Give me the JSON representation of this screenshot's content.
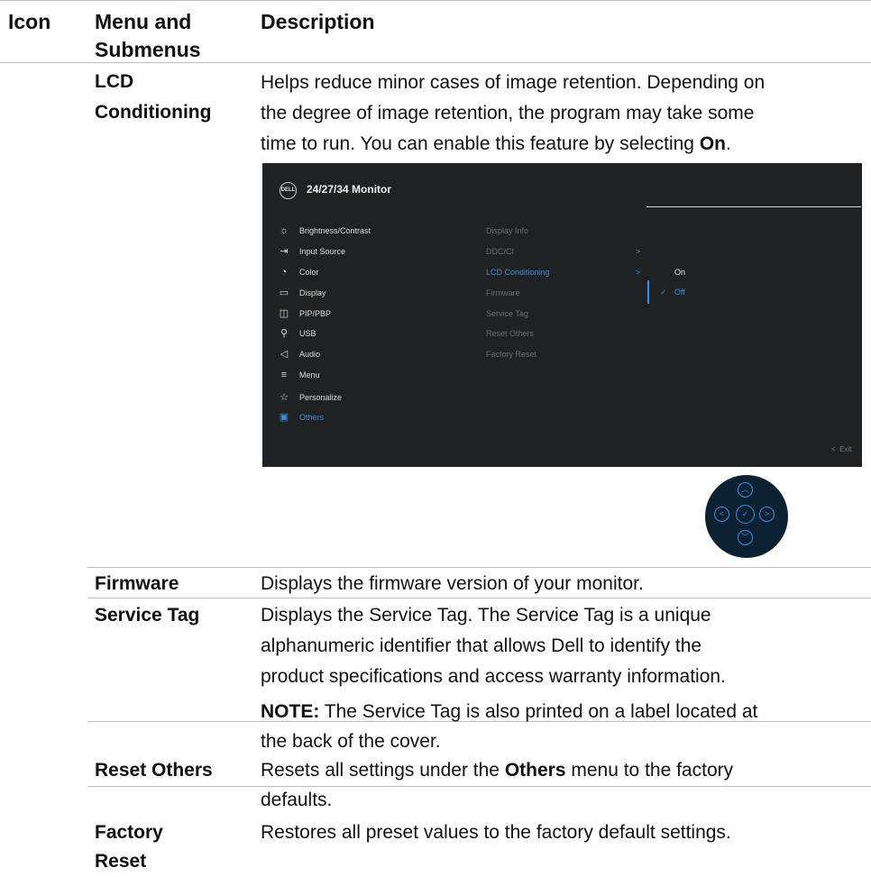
{
  "header": {
    "icon": "Icon",
    "menu_line1": "Menu and",
    "menu_line2": "Submenus",
    "description": "Description"
  },
  "rows": {
    "lcd": {
      "label_line1": "LCD",
      "label_line2": "Conditioning",
      "desc_line1": "Helps reduce minor cases of image retention. Depending on",
      "desc_line2": "the degree of image retention, the program may take some",
      "desc_line3_a": "time to run. You can enable this feature by selecting ",
      "desc_line3_bold": "On",
      "desc_line3_end": "."
    },
    "firmware": {
      "label": "Firmware",
      "desc": "Displays the firmware version of your monitor."
    },
    "service_tag": {
      "label": "Service Tag",
      "desc_line1": "Displays the Service Tag. The Service Tag is a unique",
      "desc_line2": "alphanumeric identifier that allows Dell to identify the",
      "desc_line3": "product specifications and access warranty information.",
      "note_bold": "NOTE:",
      "note_line1_rest": " The Service Tag is also printed on a label located at",
      "note_line2": "the back of the cover."
    },
    "reset_others": {
      "label": "Reset Others",
      "desc_a": "Resets all settings under the ",
      "desc_bold": "Others",
      "desc_b": " menu to the factory",
      "desc_line2": "defaults."
    },
    "factory_reset": {
      "label_line1": "Factory",
      "label_line2": "Reset",
      "desc": "Restores all preset values to the factory default settings."
    }
  },
  "osd": {
    "logo": "DELL",
    "title": "24/27/34 Monitor",
    "menu": [
      {
        "label": "Brightness/Contrast",
        "icon": "brightness-icon",
        "glyph": "☼"
      },
      {
        "label": "Input Source",
        "icon": "input-source-icon",
        "glyph": "⇥"
      },
      {
        "label": "Color",
        "icon": "color-icon",
        "glyph": "◔"
      },
      {
        "label": "Display",
        "icon": "display-icon",
        "glyph": "▭"
      },
      {
        "label": "PIP/PBP",
        "icon": "pip-pbp-icon",
        "glyph": "◫"
      },
      {
        "label": "USB",
        "icon": "usb-icon",
        "glyph": "⚲"
      },
      {
        "label": "Audio",
        "icon": "audio-icon",
        "glyph": "◁"
      },
      {
        "label": "Menu",
        "icon": "menu-icon",
        "glyph": "≡"
      },
      {
        "label": "Personalize",
        "icon": "star-icon",
        "glyph": "☆"
      },
      {
        "label": "Others",
        "icon": "others-icon",
        "glyph": "▣"
      }
    ],
    "active_menu": "Others",
    "submenu": [
      "Display Info",
      "DDC/CI",
      "LCD Conditioning",
      "Firmware",
      "Service Tag",
      "Reset Others",
      "Factory Reset"
    ],
    "active_submenu": "LCD Conditioning",
    "chevron": ">",
    "options": {
      "on": "On",
      "off": "Off",
      "selected": "Off",
      "check": "✓"
    },
    "exit": "Exit",
    "exit_glyph": "<",
    "colors": {
      "background": "#202122",
      "accent": "#3a8de2"
    }
  },
  "joystick": {
    "up": "︿",
    "down": "﹀",
    "left": "<",
    "right": ">",
    "center": "✓"
  }
}
